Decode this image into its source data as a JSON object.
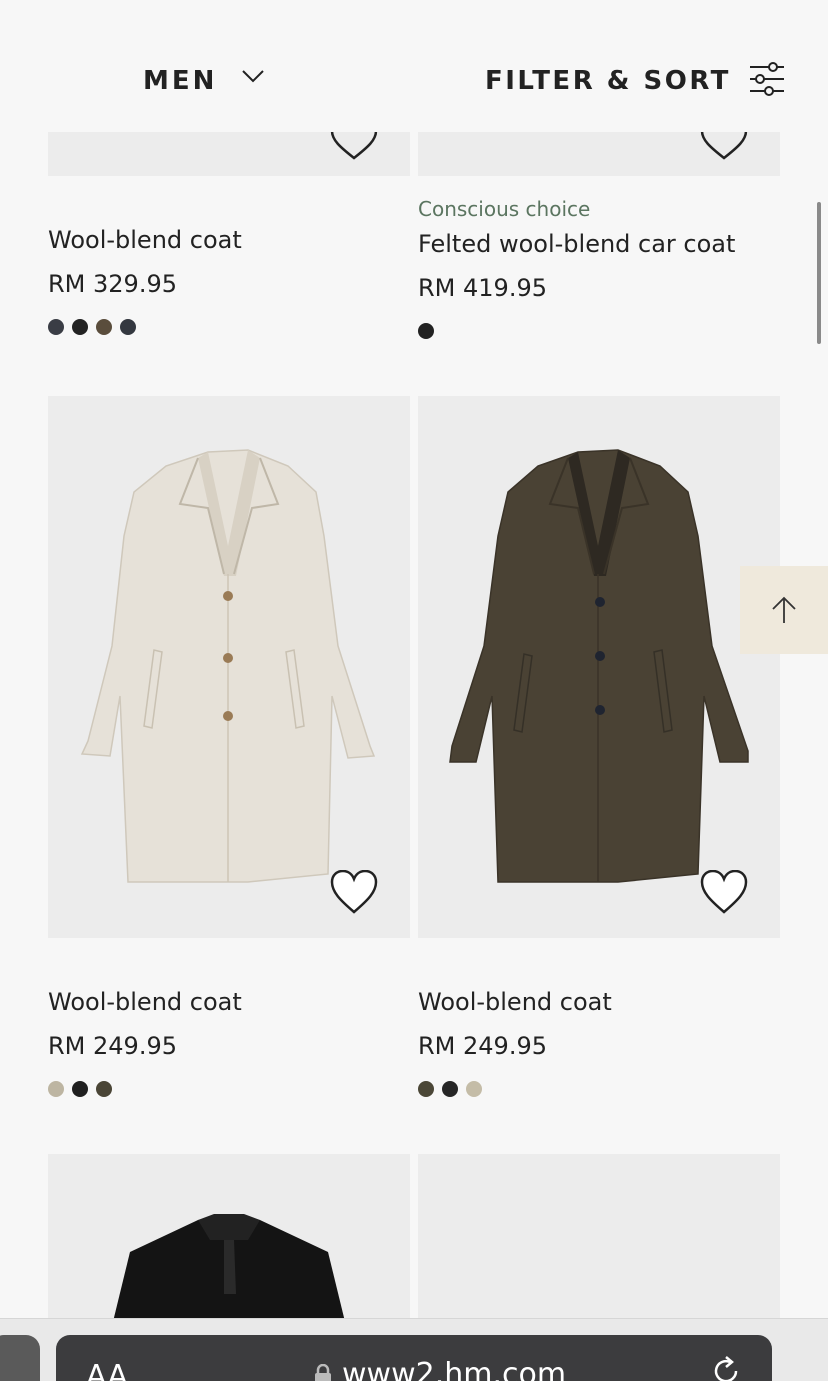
{
  "header": {
    "category_label": "MEN",
    "filter_label": "FILTER & SORT"
  },
  "products": [
    {
      "name": "Wool-blend coat",
      "price": "RM 329.95",
      "badge": "",
      "swatches": [
        "#3a3d45",
        "#222222",
        "#5a4d3c",
        "#343840"
      ]
    },
    {
      "name": "Felted wool-blend car coat",
      "price": "RM 419.95",
      "badge": "Conscious choice",
      "swatches": [
        "#222222"
      ]
    },
    {
      "name": "Wool-blend coat",
      "price": "RM 249.95",
      "badge": "",
      "swatches": [
        "#bdb5a2",
        "#1f1f1f",
        "#4a4536"
      ]
    },
    {
      "name": "Wool-blend coat",
      "price": "RM 249.95",
      "badge": "",
      "swatches": [
        "#4b4737",
        "#262626",
        "#c4bca7"
      ]
    }
  ],
  "browser": {
    "text_size_label": "AA",
    "url": "www2.hm.com"
  },
  "colors": {
    "badge_green": "#5b7560",
    "back_to_top_bg": "#efe9dc",
    "coat_beige": "#e6e1d8",
    "coat_brown": "#4a4234",
    "coat_black": "#141414"
  }
}
